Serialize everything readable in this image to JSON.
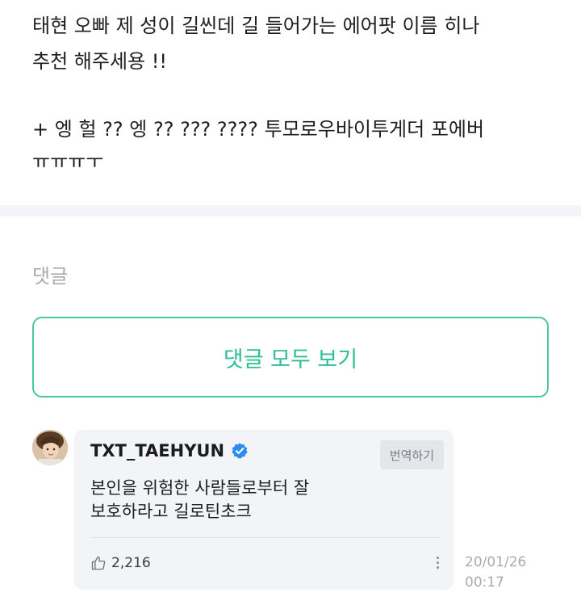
{
  "post": {
    "lines": [
      "태현 오빠 제 성이 길씬데 길 들어가는 에어팟 이름 히나",
      "추천 해주세용 !!",
      "",
      "+ 엥 헐 ?? 엥 ?? ??? ???? 투모로우바이투게더 포에버",
      "ㅠㅠㅠㅜ"
    ]
  },
  "comments": {
    "heading": "댓글",
    "view_all_label": "댓글 모두 보기"
  },
  "reply": {
    "author": "TXT_TAEHYUN",
    "verified_icon": "verified-check-icon",
    "translate_label": "번역하기",
    "text_lines": [
      "본인을 위험한 사람들로부터 잘",
      "보호하라고 길로틴초크"
    ],
    "like_icon": "thumbs-up-icon",
    "like_count": "2,216",
    "date": "20/01/26",
    "time": "00:17"
  },
  "colors": {
    "accent": "#2ebf91",
    "accent_border": "#49c7a0",
    "muted_text": "#a9abaf",
    "bubble_bg": "#f3f4f7",
    "verified_blue": "#2d8cf0"
  }
}
